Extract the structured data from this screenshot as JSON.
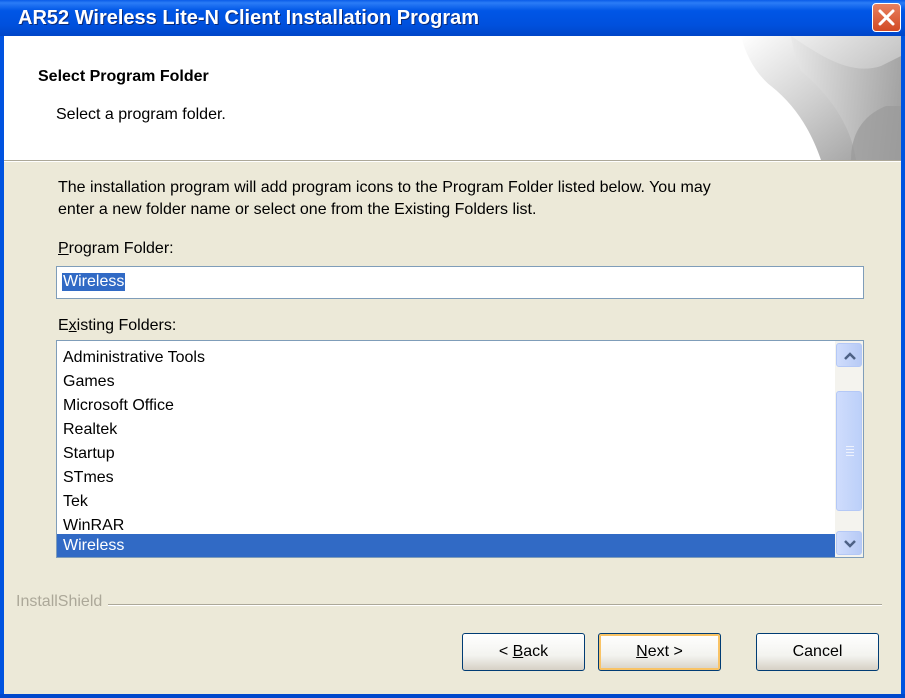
{
  "window": {
    "title": "AR52 Wireless Lite-N Client Installation Program"
  },
  "header": {
    "title": "Select Program Folder",
    "subtitle": "Select a program folder."
  },
  "description": {
    "line1": "The installation program will add program icons to the Program Folder listed below. You may",
    "line2": "enter a new folder name or select one from the Existing Folders list."
  },
  "program_folder": {
    "label_key": "P",
    "label_rest": "rogram Folder:",
    "value": "Wireless"
  },
  "existing_folders": {
    "label_pre": "E",
    "label_key": "x",
    "label_rest": "isting Folders:",
    "items": [
      "Administrative Tools",
      "Games",
      "Microsoft Office",
      "Realtek",
      "Startup",
      "STmes",
      "Tek",
      "WinRAR",
      "Wireless"
    ],
    "selected": "Wireless"
  },
  "brand": "InstallShield",
  "buttons": {
    "back_pre": "< ",
    "back_key": "B",
    "back_rest": "ack",
    "next_key": "N",
    "next_rest": "ext >",
    "cancel": "Cancel"
  },
  "colors": {
    "selection": "#316ac5",
    "titlebar": "#0054e3",
    "dialog_bg": "#ece9d8"
  }
}
